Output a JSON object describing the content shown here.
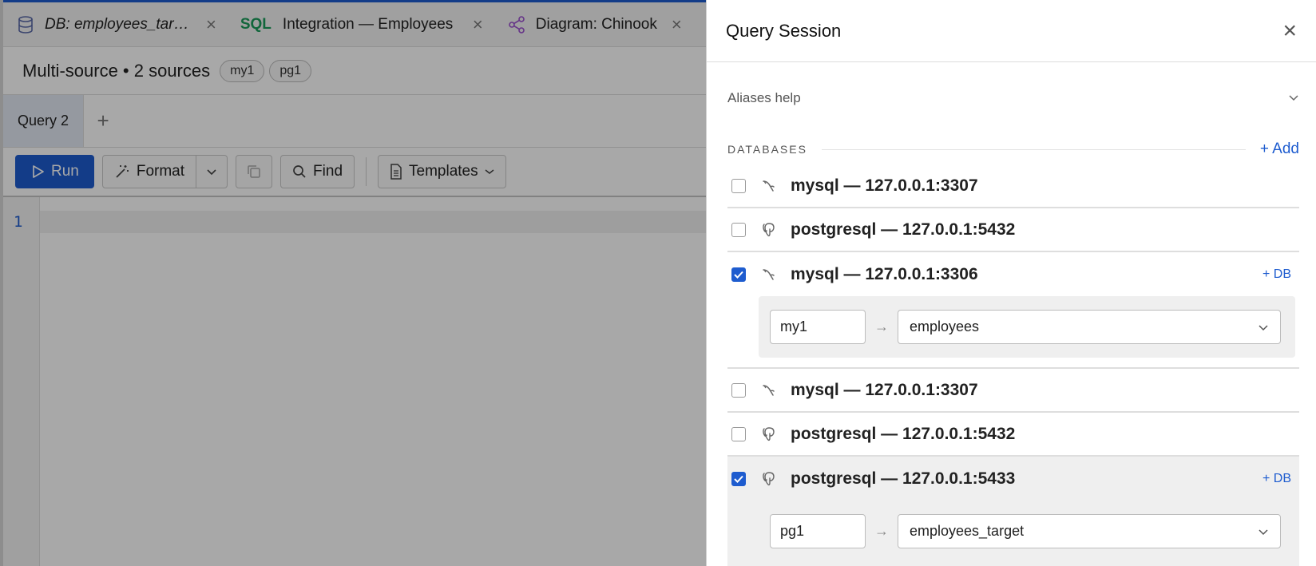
{
  "tabs": [
    {
      "label": "DB: employees_target",
      "icon": "database-icon"
    },
    {
      "tag": "SQL",
      "label": "Integration — Employees"
    },
    {
      "label": "Diagram: Chinook",
      "icon": "diagram-icon"
    }
  ],
  "context": {
    "title": "Multi-source • 2 sources",
    "chips": [
      "my1",
      "pg1"
    ]
  },
  "query_tabs": [
    {
      "label": "Query 2"
    }
  ],
  "toolbar": {
    "run": "Run",
    "format": "Format",
    "find": "Find",
    "templates": "Templates"
  },
  "editor": {
    "line_numbers": [
      "1"
    ]
  },
  "drawer": {
    "title": "Query Session",
    "aliases_help": "Aliases help",
    "databases_label": "DATABASES",
    "add_label": "+ Add",
    "plus_db": "+ DB",
    "connections": [
      {
        "name": "mysql — 127.0.0.1:3307",
        "engine": "mysql",
        "checked": false
      },
      {
        "name": "postgresql — 127.0.0.1:5432",
        "engine": "postgresql",
        "checked": false
      },
      {
        "name": "mysql — 127.0.0.1:3306",
        "engine": "mysql",
        "checked": true,
        "alias": "my1",
        "database": "employees"
      },
      {
        "name": "mysql — 127.0.0.1:3307",
        "engine": "mysql",
        "checked": false
      },
      {
        "name": "postgresql — 127.0.0.1:5432",
        "engine": "postgresql",
        "checked": false
      },
      {
        "name": "postgresql — 127.0.0.1:5433",
        "engine": "postgresql",
        "checked": true,
        "alias": "pg1",
        "database": "employees_target"
      }
    ]
  },
  "colors": {
    "accent": "#1e5ccf",
    "sql": "#1a9b5a",
    "diagram": "#9b4fcf"
  }
}
